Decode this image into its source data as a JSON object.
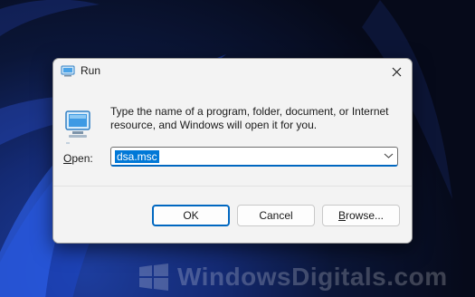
{
  "dialog": {
    "title": "Run",
    "message": "Type the name of a program, folder, document, or Internet resource, and Windows will open it for you.",
    "open_label_accel": "O",
    "open_label_rest": "pen:",
    "open_value": "dsa.msc",
    "buttons": {
      "ok": "OK",
      "cancel": "Cancel",
      "browse_accel": "B",
      "browse_rest": "rowse..."
    }
  },
  "watermark": {
    "text": "WindowsDigitals.com"
  },
  "icons": {
    "title": "run-app-icon",
    "body": "run-app-icon",
    "close": "close-icon",
    "dropdown": "chevron-down-icon",
    "watermark_logo": "windows-logo-icon"
  },
  "colors": {
    "accent": "#0067c0",
    "selection": "#0078d7",
    "dialog_bg": "#f3f3f3"
  }
}
